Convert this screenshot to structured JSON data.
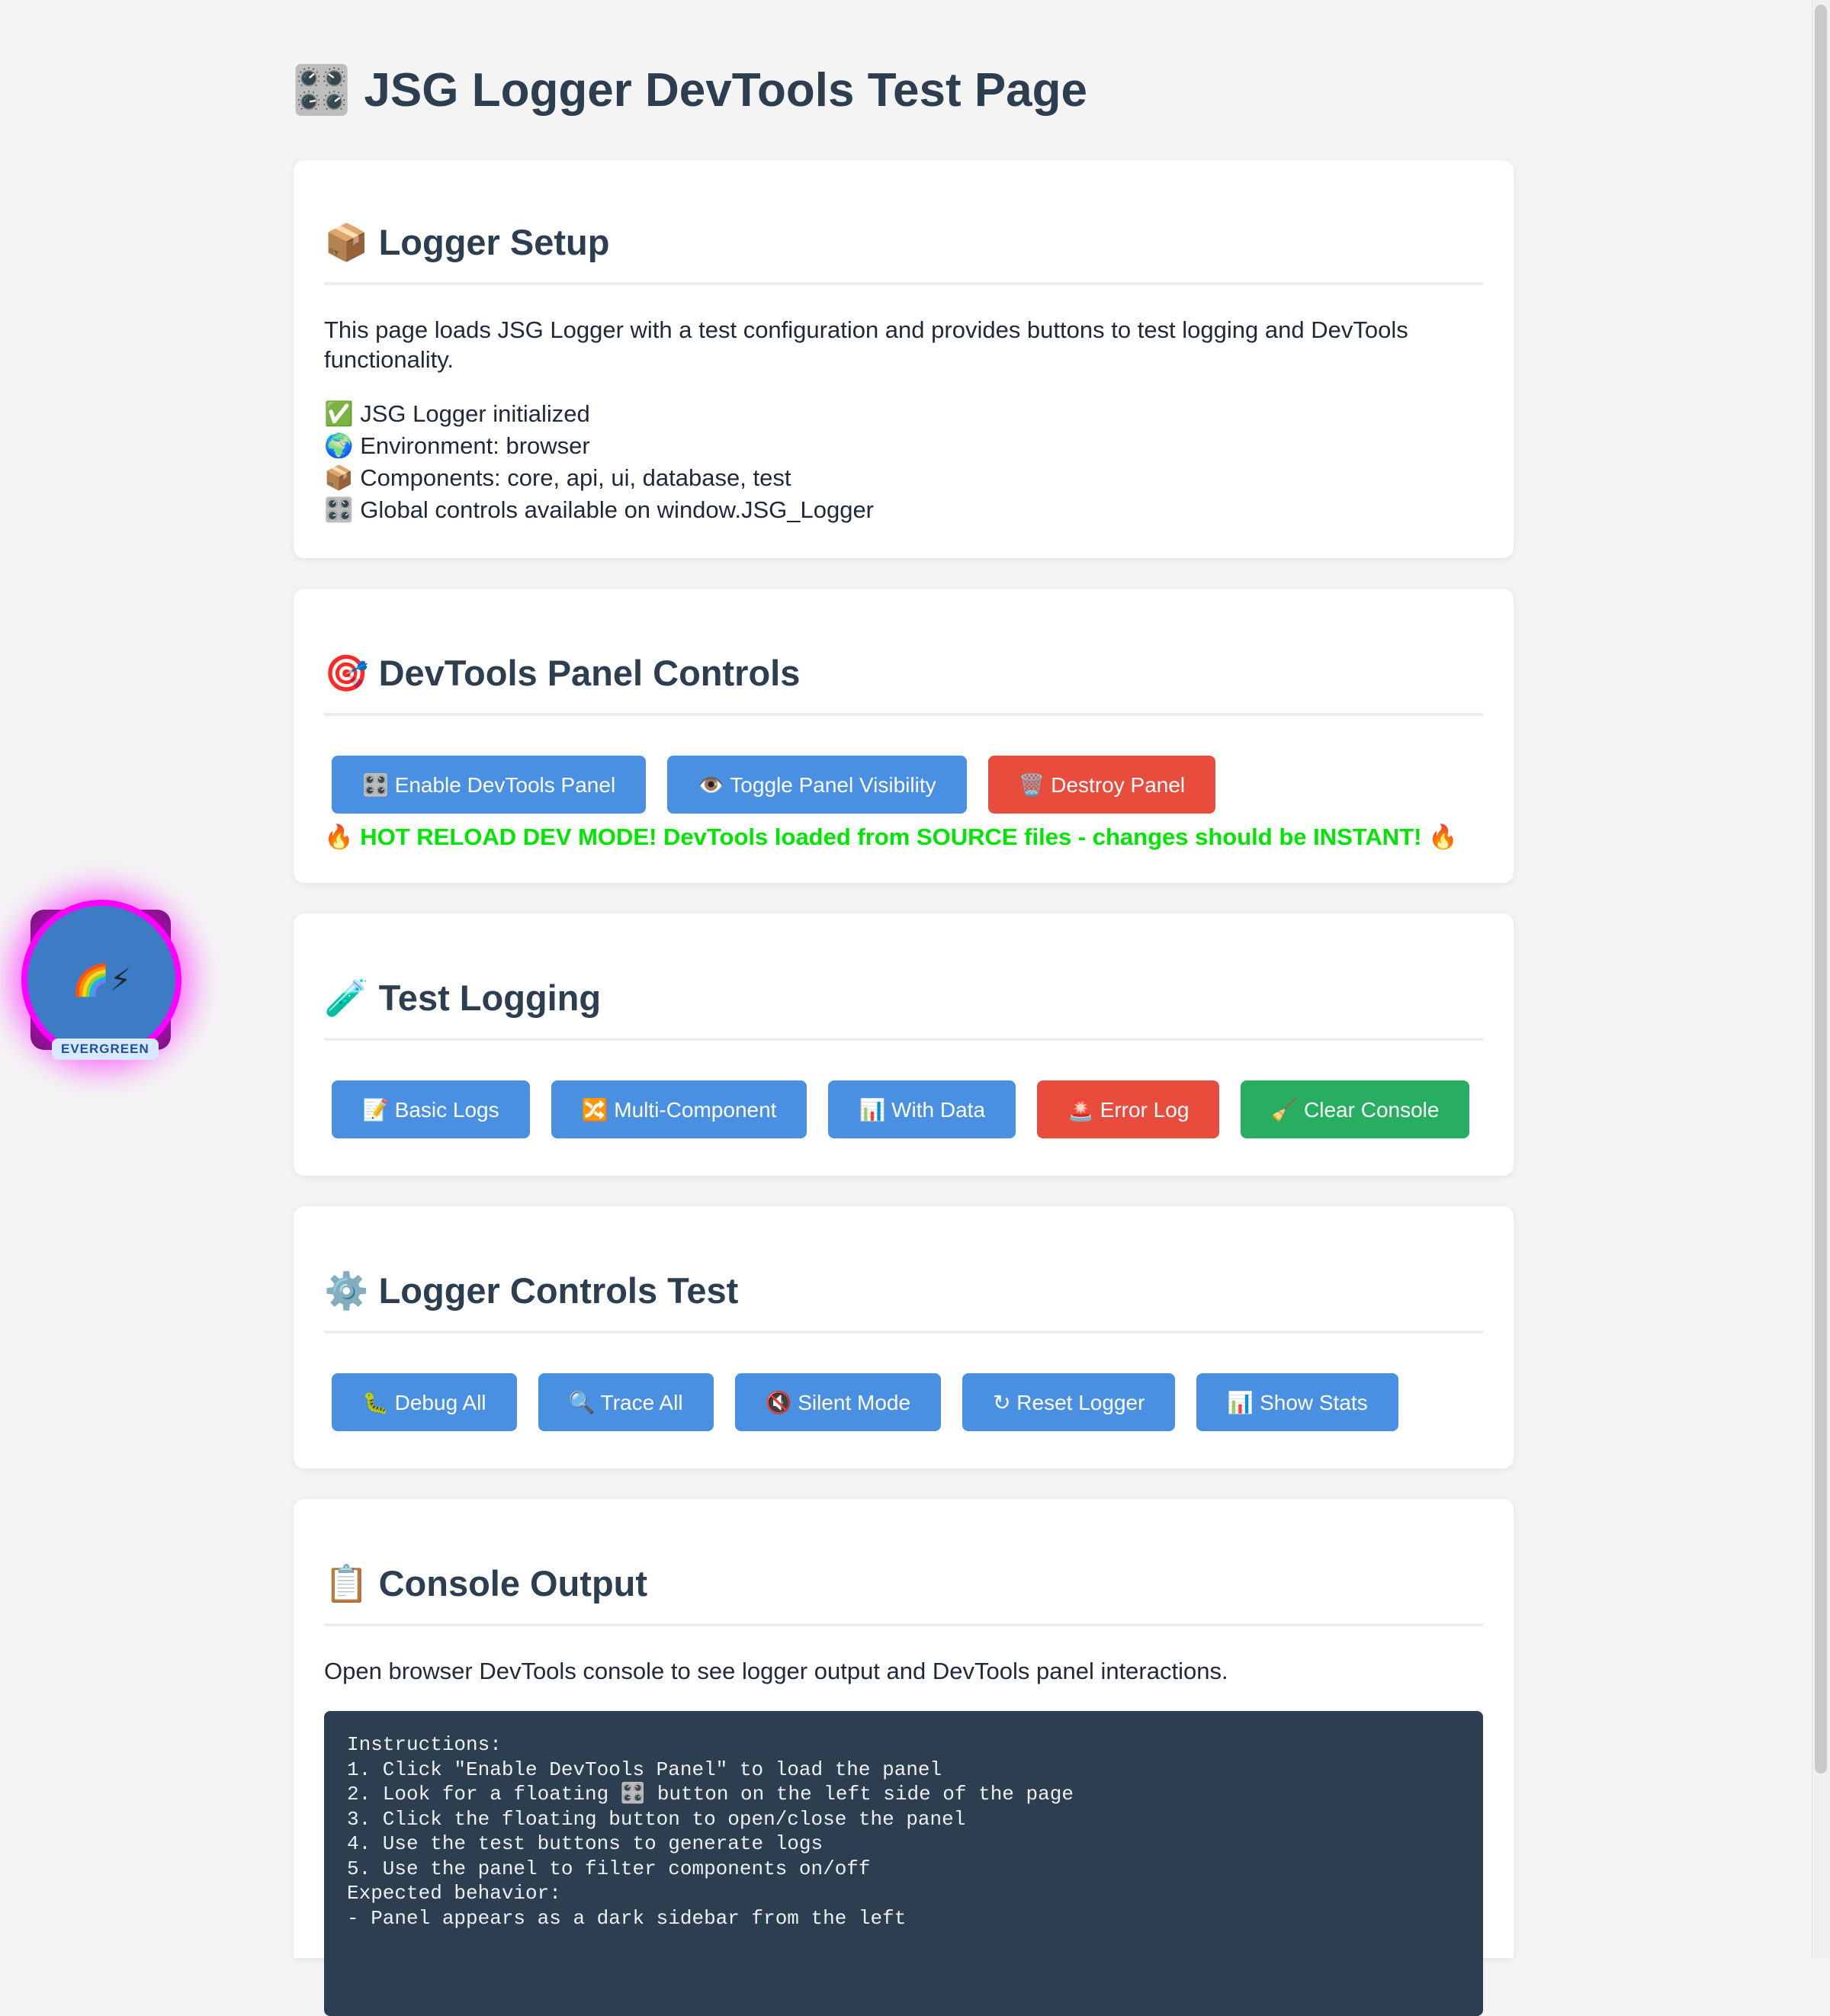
{
  "page": {
    "title": "🎛️ JSG Logger DevTools Test Page"
  },
  "setup": {
    "heading": "📦 Logger Setup",
    "description": "This page loads JSG Logger with a test configuration and provides buttons to test logging and DevTools functionality.",
    "status": [
      "✅ JSG Logger initialized",
      "🌍 Environment: browser",
      "📦 Components: core, api, ui, database, test",
      "🎛️ Global controls available on window.JSG_Logger"
    ]
  },
  "panel_controls": {
    "heading": "🎯 DevTools Panel Controls",
    "buttons": [
      {
        "label": "🎛️ Enable DevTools Panel",
        "color": "#4a90e2"
      },
      {
        "label": "👁️ Toggle Panel Visibility",
        "color": "#4a90e2"
      },
      {
        "label": "🗑️ Destroy Panel",
        "color": "#e74c3c"
      }
    ],
    "hot_reload_text": "🔥 HOT RELOAD DEV MODE! DevTools loaded from SOURCE files - changes should be INSTANT! 🔥"
  },
  "test_logging": {
    "heading": "🧪 Test Logging",
    "buttons": [
      {
        "label": "📝 Basic Logs",
        "color": "#4a90e2"
      },
      {
        "label": "🔀 Multi-Component",
        "color": "#4a90e2"
      },
      {
        "label": "📊 With Data",
        "color": "#4a90e2"
      },
      {
        "label": "🚨 Error Log",
        "color": "#e74c3c"
      },
      {
        "label": "🧹 Clear Console",
        "color": "#27ae60"
      }
    ]
  },
  "logger_controls": {
    "heading": "⚙️ Logger Controls Test",
    "buttons": [
      {
        "label": "🐛 Debug All",
        "color": "#4a90e2"
      },
      {
        "label": "🔍 Trace All",
        "color": "#4a90e2"
      },
      {
        "label": "🔇 Silent Mode",
        "color": "#4a90e2"
      },
      {
        "label": "↻ Reset Logger",
        "color": "#4a90e2"
      },
      {
        "label": "📊 Show Stats",
        "color": "#4a90e2"
      }
    ]
  },
  "console_output": {
    "heading": "📋 Console Output",
    "description": "Open browser DevTools console to see logger output and DevTools panel interactions.",
    "lines": [
      "Instructions:",
      "1. Click \"Enable DevTools Panel\" to load the panel",
      "2. Look for a floating 🎛️ button on the left side of the page",
      "3. Click the floating button to open/close the panel",
      "4. Use the test buttons to generate logs",
      "5. Use the panel to filter components on/off",
      "",
      "Expected behavior:",
      "- Panel appears as a dark sidebar from the left"
    ]
  },
  "floating_button": {
    "icon": "🌈⚡",
    "badge": "EVERGREEN"
  },
  "colors": {
    "primary": "#4a90e2",
    "danger": "#e74c3c",
    "success": "#27ae60",
    "heading": "#2c3e50",
    "hot_reload": "#00e600",
    "fab_ring": "#ff00ff"
  }
}
